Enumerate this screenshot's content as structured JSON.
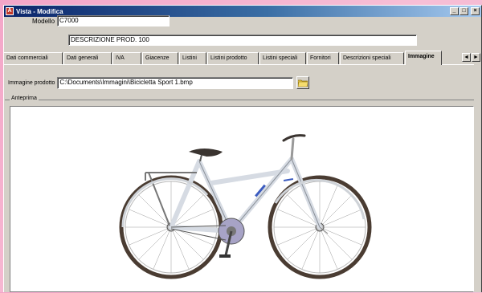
{
  "window": {
    "title": "Vista - Modifica",
    "icon_label": "A",
    "controls": [
      "_",
      "□",
      "×"
    ]
  },
  "form": {
    "code_label": "Modello",
    "code_value": "C7000",
    "description_value": "DESCRIZIONE PROD. 100"
  },
  "tabs": [
    {
      "label": "Dati commerciali"
    },
    {
      "label": "Dati generali"
    },
    {
      "label": "IVA"
    },
    {
      "label": "Giacenze"
    },
    {
      "label": "Listini"
    },
    {
      "label": "Listini prodotto"
    },
    {
      "label": "Listini speciali"
    },
    {
      "label": "Fornitori"
    },
    {
      "label": "Descrizioni speciali"
    },
    {
      "label": "Immagine"
    }
  ],
  "tab_scroll": [
    "◄",
    "►"
  ],
  "image_file": {
    "label": "Immagine prodotto",
    "path": "C:\\Documents\\Immagini\\Bicicletta Sport 1.bmp"
  },
  "preview": {
    "group_label": "Anteprima"
  },
  "colors": {
    "face": "#d4d0c8",
    "title_start": "#0a246a",
    "title_end": "#a6caf0"
  }
}
